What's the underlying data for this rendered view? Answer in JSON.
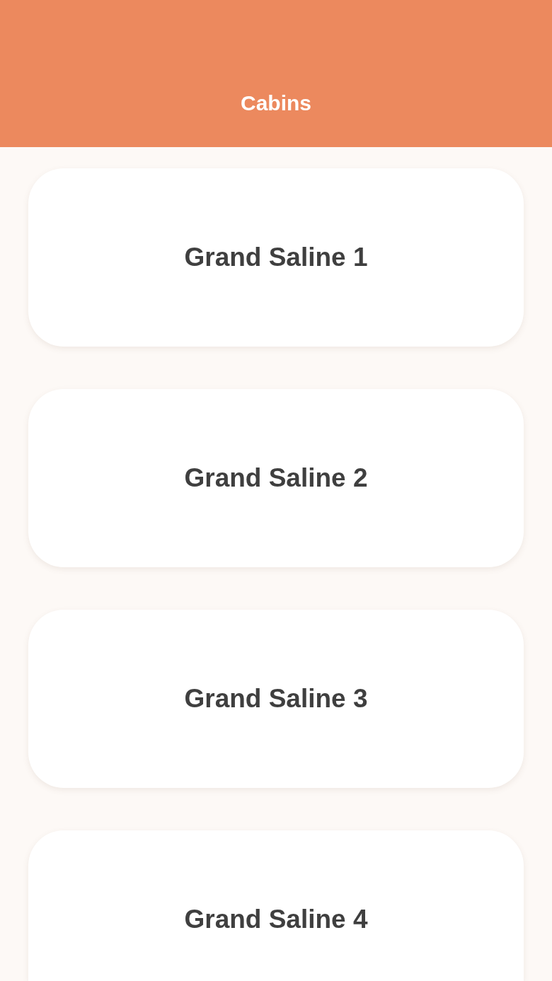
{
  "header": {
    "title": "Cabins"
  },
  "cabins": [
    {
      "name": "Grand Saline 1"
    },
    {
      "name": "Grand Saline 2"
    },
    {
      "name": "Grand Saline 3"
    },
    {
      "name": "Grand Saline 4"
    }
  ]
}
